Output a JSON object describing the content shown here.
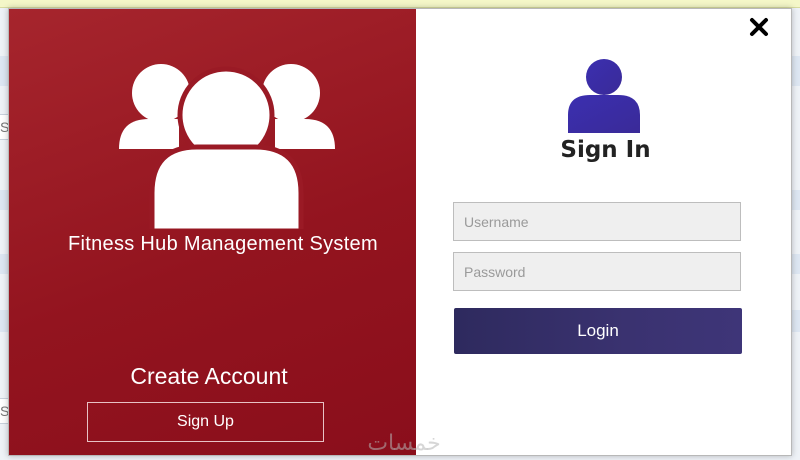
{
  "left_panel": {
    "app_title": "Fitness Hub Management System",
    "create_account_title": "Create Account",
    "signup_label": "Sign Up",
    "icon": "group-users-icon"
  },
  "right_panel": {
    "title": "Sign In",
    "icon": "user-icon",
    "username": {
      "value": "",
      "placeholder": "Username"
    },
    "password": {
      "value": "",
      "placeholder": "Password"
    },
    "login_label": "Login",
    "close_icon": "close-icon"
  },
  "background": {
    "letters": [
      "S",
      "S"
    ]
  },
  "watermark": "خمسات",
  "colors": {
    "left_panel": "#93141f",
    "user_icon": "#3a2fa6",
    "login_button": "#342e68"
  }
}
